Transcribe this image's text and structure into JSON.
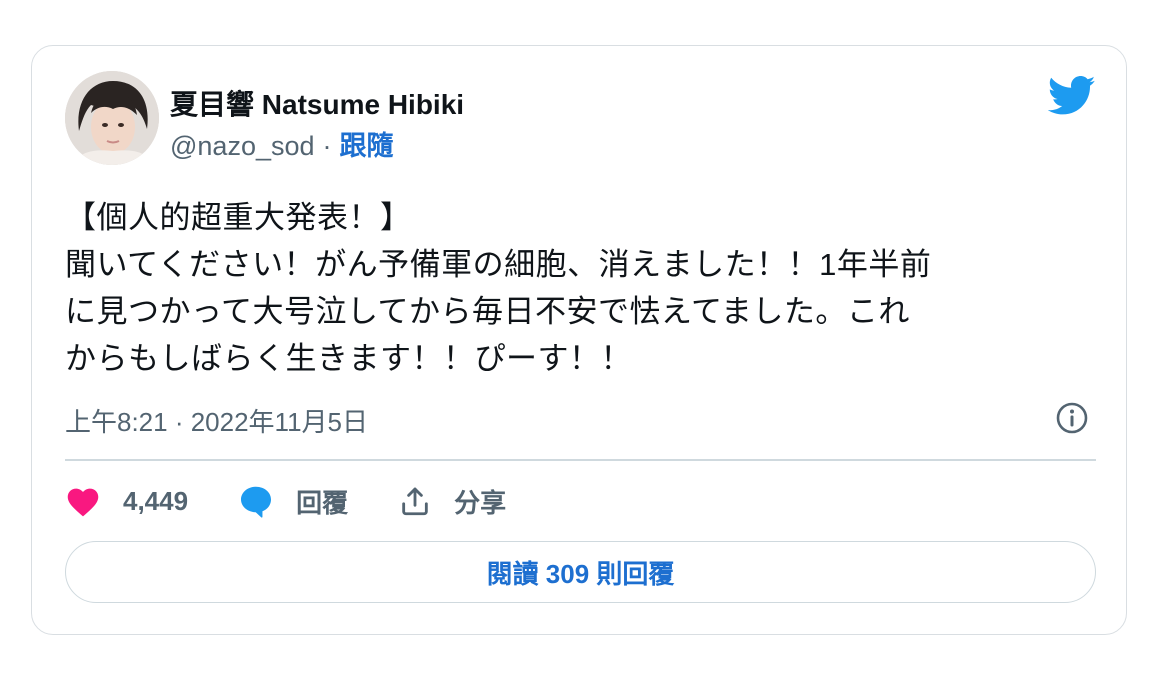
{
  "author": {
    "display_name": "夏目響 Natsume Hibiki",
    "handle": "@nazo_sod",
    "separator": "·",
    "follow_label": "跟隨"
  },
  "brand": {
    "icon": "twitter-bird-icon",
    "color": "#1d9bf0"
  },
  "tweet": {
    "text": "【個人的超重大発表！】\n聞いてください！がん予備軍の細胞、消えました！！1年半前\nに見つかって大号泣してから毎日不安で怯えてました。これ\nからもしばらく生きます！！ぴーす！！",
    "timestamp": "上午8:21 · 2022年11月5日"
  },
  "actions": {
    "like_count": "4,449",
    "reply_label": "回覆",
    "share_label": "分享"
  },
  "footer": {
    "read_replies_label": "閱讀 309 則回覆"
  },
  "colors": {
    "like": "#f91880",
    "reply": "#1d9bf0",
    "link": "#1d6fd0",
    "muted": "#536471"
  }
}
